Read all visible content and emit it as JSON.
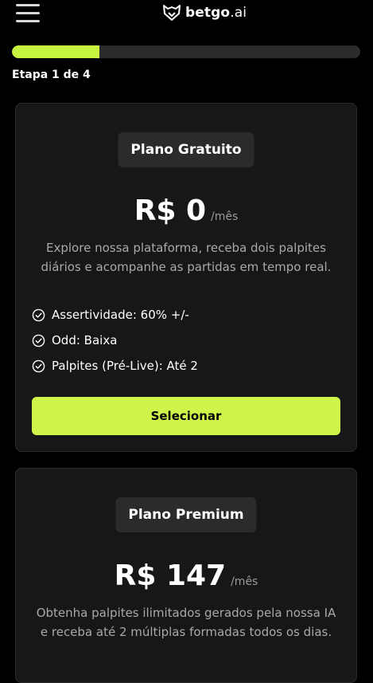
{
  "header": {
    "logo_text_bold": "betgo",
    "logo_text_light": ".ai",
    "menu_icon": "hamburger-menu-icon",
    "logo_icon": "fox-icon"
  },
  "progress": {
    "step_label": "Etapa 1 de 4",
    "current_step": 1,
    "total_steps": 4,
    "fill_color": "#c6f43f"
  },
  "plans": [
    {
      "name": "Plano Gratuito",
      "price": "R$ 0",
      "period": "/mês",
      "description": "Explore nossa plataforma, receba dois palpites diários e acompanhe as partidas em tempo real.",
      "features": [
        "Assertividade: 60% +/-",
        "Odd: Baixa",
        "Palpites (Pré-Live): Até 2"
      ],
      "button_label": "Selecionar"
    },
    {
      "name": "Plano Premium",
      "price": "R$ 147",
      "period": "/mês",
      "description": "Obtenha palpites ilimitados gerados pela nossa IA e receba até 2 múltiplas formadas todos os dias."
    }
  ],
  "colors": {
    "accent": "#d0f54a",
    "background": "#000000",
    "card": "#171717",
    "pill": "#2b2b2b"
  }
}
